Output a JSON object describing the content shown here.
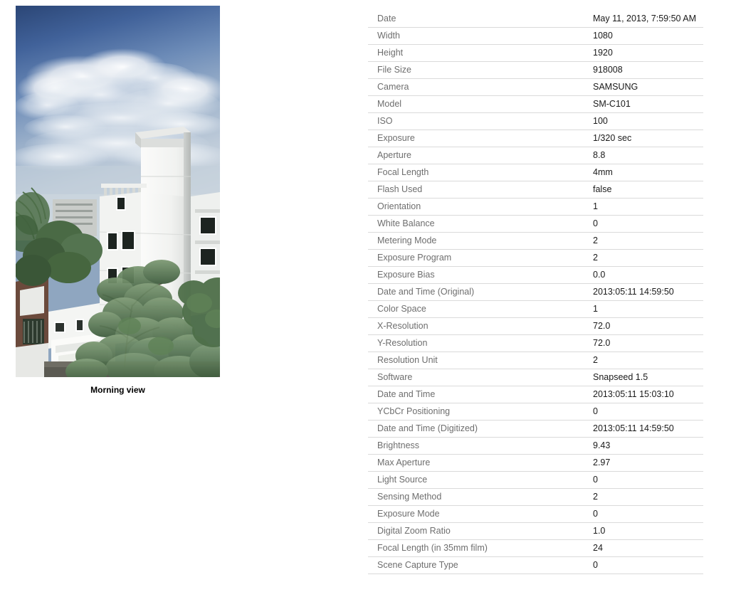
{
  "photo": {
    "caption": "Morning view",
    "alt": "Morning view of a white multi-storey building with rooftop stair block under a blue sky with white clouds, surrounded by green trees",
    "colors": {
      "sky_top": "#2e4a7d",
      "sky_mid": "#7b98bf",
      "sky_low": "#b8c6d8",
      "cloud": "#f2f4f7",
      "building_light": "#f4f4f2",
      "building_shade": "#d9dbd9",
      "building_dark": "#bfc2c0",
      "window": "#1d2420",
      "foliage": "#5d7a5a",
      "foliage_dark": "#3f5c3e",
      "foliage_light": "#86a07e",
      "brick": "#6b4a3c",
      "ground": "#6d6a62"
    }
  },
  "metadata": {
    "rows": [
      {
        "label": "Date",
        "value": "May 11, 2013, 7:59:50 AM"
      },
      {
        "label": "Width",
        "value": "1080"
      },
      {
        "label": "Height",
        "value": "1920"
      },
      {
        "label": "File Size",
        "value": "918008"
      },
      {
        "label": "Camera",
        "value": "SAMSUNG"
      },
      {
        "label": "Model",
        "value": "SM-C101"
      },
      {
        "label": "ISO",
        "value": "100"
      },
      {
        "label": "Exposure",
        "value": "1/320 sec"
      },
      {
        "label": "Aperture",
        "value": "8.8"
      },
      {
        "label": "Focal Length",
        "value": "4mm"
      },
      {
        "label": "Flash Used",
        "value": "false"
      },
      {
        "label": "Orientation",
        "value": "1"
      },
      {
        "label": "White Balance",
        "value": "0"
      },
      {
        "label": "Metering Mode",
        "value": "2"
      },
      {
        "label": "Exposure Program",
        "value": "2"
      },
      {
        "label": "Exposure Bias",
        "value": "0.0"
      },
      {
        "label": "Date and Time (Original)",
        "value": "2013:05:11 14:59:50"
      },
      {
        "label": "Color Space",
        "value": "1"
      },
      {
        "label": "X-Resolution",
        "value": "72.0"
      },
      {
        "label": "Y-Resolution",
        "value": "72.0"
      },
      {
        "label": "Resolution Unit",
        "value": "2"
      },
      {
        "label": "Software",
        "value": "Snapseed 1.5"
      },
      {
        "label": "Date and Time",
        "value": "2013:05:11 15:03:10"
      },
      {
        "label": "YCbCr Positioning",
        "value": "0"
      },
      {
        "label": "Date and Time (Digitized)",
        "value": "2013:05:11 14:59:50"
      },
      {
        "label": "Brightness",
        "value": "9.43"
      },
      {
        "label": "Max Aperture",
        "value": "2.97"
      },
      {
        "label": "Light Source",
        "value": "0"
      },
      {
        "label": "Sensing Method",
        "value": "2"
      },
      {
        "label": "Exposure Mode",
        "value": "0"
      },
      {
        "label": "Digital Zoom Ratio",
        "value": "1.0"
      },
      {
        "label": "Focal Length (in 35mm film)",
        "value": "24"
      },
      {
        "label": "Scene Capture Type",
        "value": "0"
      }
    ]
  }
}
